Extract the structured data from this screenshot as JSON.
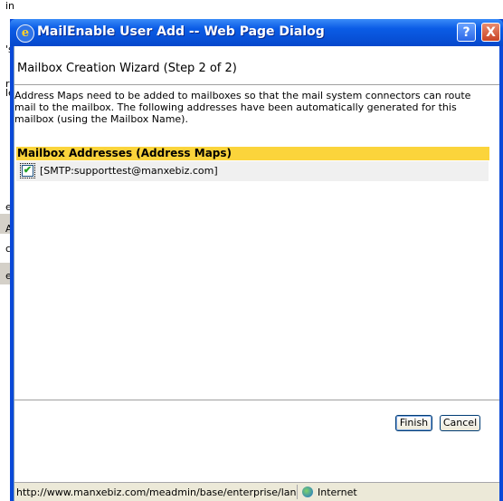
{
  "background": {
    "fragments": [
      "in",
      "'s",
      "r",
      "le",
      "e",
      "A",
      "c",
      "e"
    ]
  },
  "dialog": {
    "title": "MailEnable User Add -- Web Page Dialog",
    "help_label": "?",
    "close_label": "X",
    "icon": "ie-icon"
  },
  "wizard": {
    "title": "Mailbox Creation Wizard (Step 2 of 2)",
    "description": "Address Maps need to be added to mailboxes so that the mail system connectors can route mail to the mailbox. The following addresses have been automatically generated for this mailbox (using the Mailbox Name)."
  },
  "addresses": {
    "header": "Mailbox Addresses (Address Maps)",
    "items": [
      {
        "label": "[SMTP:supporttest@manxebiz.com]",
        "checked": true
      }
    ]
  },
  "buttons": {
    "finish": "Finish",
    "cancel": "Cancel"
  },
  "statusbar": {
    "url": "http://www.manxebiz.com/meadmin/base/enterprise/lang/",
    "zone": "Internet"
  },
  "colors": {
    "titlebar": "#0b5ce6",
    "section_header": "#fbd43b",
    "close_button": "#c94324"
  }
}
